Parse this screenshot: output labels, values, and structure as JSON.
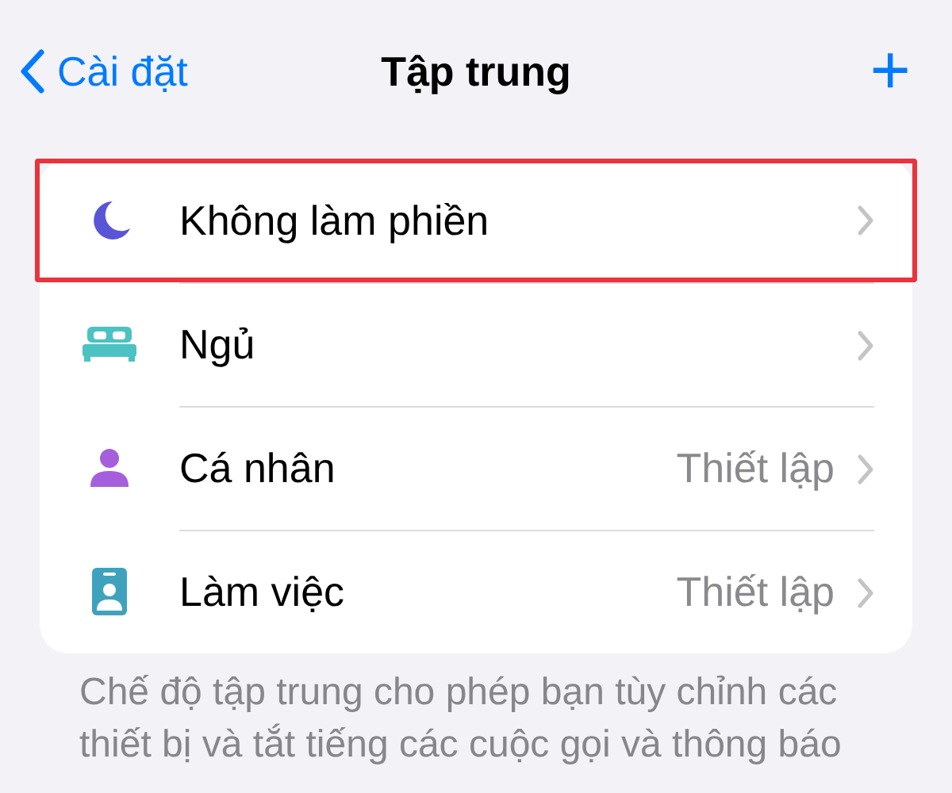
{
  "nav": {
    "back_label": "Cài đặt",
    "title": "Tập trung",
    "add": "+"
  },
  "items": [
    {
      "label": "Không làm phiền",
      "kind": "moon",
      "color": "#5856d6",
      "value": null,
      "highlighted": true
    },
    {
      "label": "Ngủ",
      "kind": "bed",
      "color": "#4cc2c2",
      "value": null,
      "highlighted": false
    },
    {
      "label": "Cá nhân",
      "kind": "person",
      "color": "#a55fdc",
      "value": "Thiết lập",
      "highlighted": false
    },
    {
      "label": "Làm việc",
      "kind": "badge",
      "color": "#3fa2bd",
      "value": "Thiết lập",
      "highlighted": false
    }
  ],
  "footer": "Chế độ tập trung cho phép bạn tùy chỉnh các thiết bị và tắt tiếng các cuộc gọi và thông báo"
}
